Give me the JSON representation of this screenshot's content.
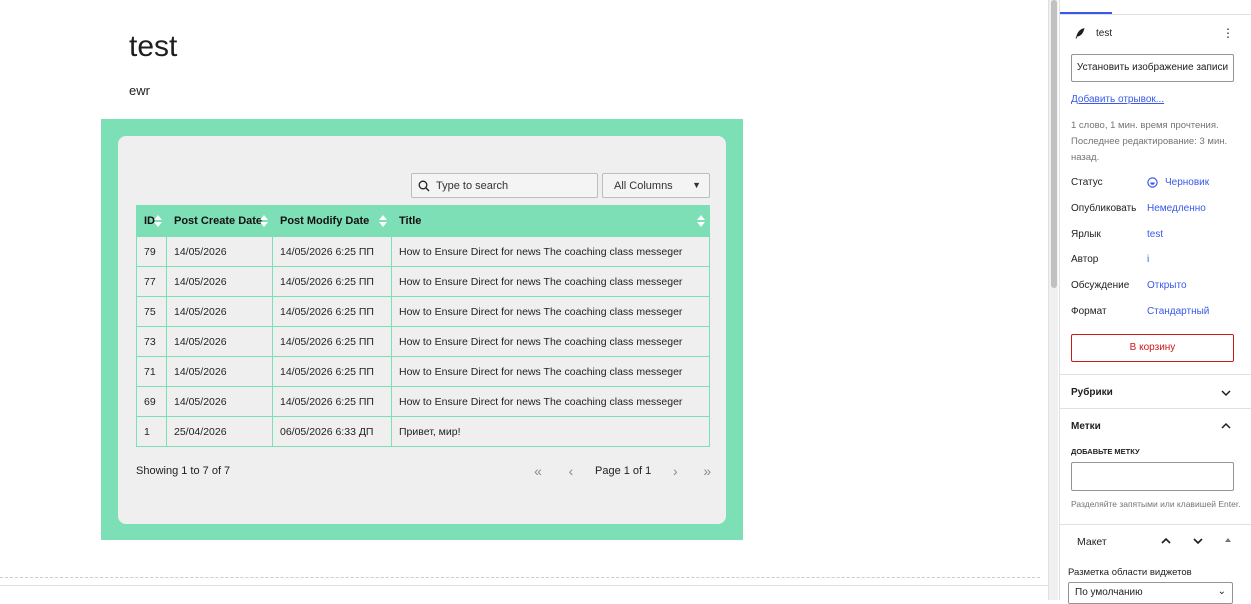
{
  "post": {
    "title": "test",
    "paragraph": "ewr"
  },
  "table_widget": {
    "search_placeholder": "Type to search",
    "column_filter": "All Columns",
    "columns": [
      "ID",
      "Post Create Date",
      "Post Modify Date",
      "Title"
    ],
    "rows": [
      [
        "79",
        "14/05/2026",
        "14/05/2026 6:25 ПП",
        "How to Ensure Direct for news The coaching class messeger"
      ],
      [
        "77",
        "14/05/2026",
        "14/05/2026 6:25 ПП",
        "How to Ensure Direct for news The coaching class messeger"
      ],
      [
        "75",
        "14/05/2026",
        "14/05/2026 6:25 ПП",
        "How to Ensure Direct for news The coaching class messeger"
      ],
      [
        "73",
        "14/05/2026",
        "14/05/2026 6:25 ПП",
        "How to Ensure Direct for news The coaching class messeger"
      ],
      [
        "71",
        "14/05/2026",
        "14/05/2026 6:25 ПП",
        "How to Ensure Direct for news The coaching class messeger"
      ],
      [
        "69",
        "14/05/2026",
        "14/05/2026 6:25 ПП",
        "How to Ensure Direct for news The coaching class messeger"
      ],
      [
        "1",
        "25/04/2026",
        "06/05/2026 6:33 ДП",
        "Привет, мир!"
      ]
    ],
    "showing": "Showing 1 to 7 of 7",
    "page_label": "Page 1 of 1",
    "accent_color": "#7ddfb5"
  },
  "sidebar": {
    "doc_title": "test",
    "featured_image_button": "Установить изображение записи",
    "excerpt_link": "Добавить отрывок...",
    "meta_line1": "1 слово, 1 мин. время прочтения.",
    "meta_line2": "Последнее редактирование: 3 мин. назад.",
    "props": [
      {
        "label": "Статус",
        "value": "Черновик"
      },
      {
        "label": "Опубликовать",
        "value": "Немедленно"
      },
      {
        "label": "Ярлык",
        "value": "test"
      },
      {
        "label": "Автор",
        "value": "i"
      },
      {
        "label": "Обсуждение",
        "value": "Открыто"
      },
      {
        "label": "Формат",
        "value": "Стандартный"
      }
    ],
    "trash_button": "В корзину",
    "categories_title": "Рубрики",
    "tags_title": "Метки",
    "tags_add_label": "ДОБАВЬТЕ МЕТКУ",
    "tags_help": "Разделяйте запятыми или клавишей Enter.",
    "layout_title": "Макет",
    "widget_area_label": "Разметка области виджетов",
    "widget_area_value": "По умолчанию",
    "link_color": "#3858e9",
    "danger_color": "#cc1818"
  }
}
